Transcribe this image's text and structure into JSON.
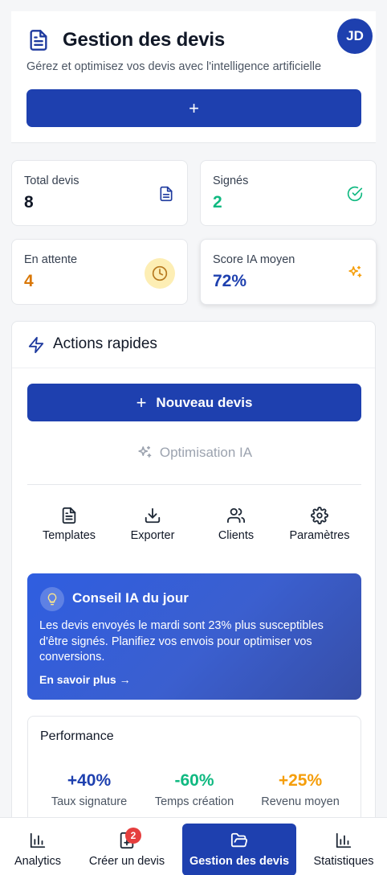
{
  "header": {
    "title": "Gestion des devis",
    "subtitle": "Gérez et optimisez vos devis avec l'intelligence artificielle",
    "avatar_initials": "JD",
    "plus_label": "+"
  },
  "stats": [
    {
      "label": "Total devis",
      "value": "8",
      "color": "#111827",
      "icon": "document-icon"
    },
    {
      "label": "Signés",
      "value": "2",
      "color": "#10b981",
      "icon": "check-circle-icon"
    },
    {
      "label": "En attente",
      "value": "4",
      "color": "#d97706",
      "icon": "clock-icon"
    },
    {
      "label": "Score IA moyen",
      "value": "72%",
      "color": "#1e40af",
      "icon": "sparkles-icon"
    }
  ],
  "actions": {
    "title": "Actions rapides",
    "new_button": "Nouveau devis",
    "new_button_plus": "+",
    "optimize_label": "Optimisation IA",
    "tools": [
      {
        "label": "Templates",
        "icon": "file-text-icon"
      },
      {
        "label": "Exporter",
        "icon": "download-icon"
      },
      {
        "label": "Clients",
        "icon": "users-icon"
      },
      {
        "label": "Paramètres",
        "icon": "gear-icon"
      }
    ]
  },
  "tip": {
    "title": "Conseil IA du jour",
    "text": "Les devis envoyés le mardi sont 23% plus susceptibles d'être signés. Planifiez vos envois pour optimiser vos conversions.",
    "link": "En savoir plus →"
  },
  "performance": {
    "title": "Performance",
    "metrics": [
      {
        "value": "+40%",
        "label": "Taux signature",
        "color": "#1e40af"
      },
      {
        "value": "-60%",
        "label": "Temps création",
        "color": "#10b981"
      },
      {
        "value": "+25%",
        "label": "Revenu moyen",
        "color": "#f59e0b"
      }
    ]
  },
  "bottom_nav": {
    "items": [
      {
        "label": "Analytics",
        "icon": "bar-chart-icon"
      },
      {
        "label": "Créer un devis",
        "icon": "document-plus-icon",
        "badge": "2"
      },
      {
        "label": "Gestion des devis",
        "icon": "folder-open-icon",
        "active": true
      },
      {
        "label": "Statistiques",
        "icon": "bar-chart-icon"
      }
    ]
  },
  "colors": {
    "primary": "#1e40af",
    "success": "#10b981",
    "warning": "#d97706",
    "badge": "#e53e3e"
  }
}
